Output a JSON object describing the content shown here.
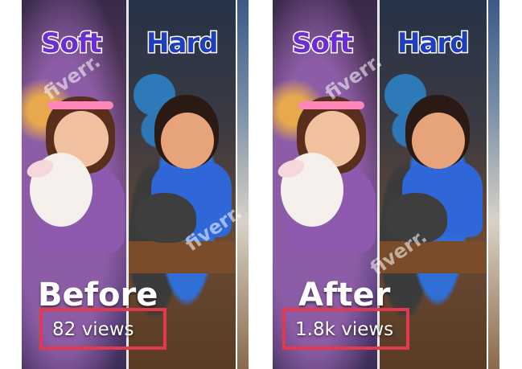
{
  "before": {
    "label_soft": "Soft",
    "label_hard": "Hard",
    "title": "Before",
    "views": "82 views"
  },
  "after": {
    "label_soft": "Soft",
    "label_hard": "Hard",
    "title": "After",
    "views": "1.8k views"
  },
  "watermark": "fiverr.",
  "colors": {
    "soft_label": "#6b2fd1",
    "hard_label": "#1d3fbf",
    "highlight_box": "#e5394b"
  }
}
